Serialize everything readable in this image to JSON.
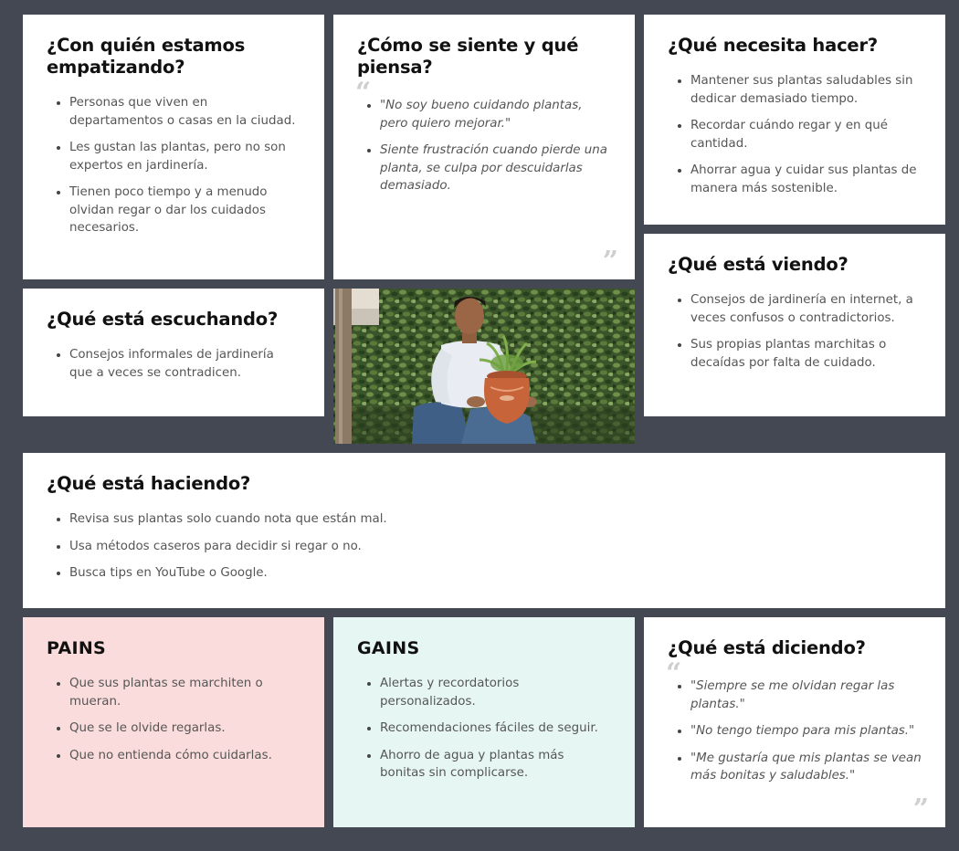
{
  "who": {
    "title": "¿Con quién estamos empatizando?",
    "items": [
      "Personas que viven en departamentos o casas en la ciudad.",
      "Les gustan las plantas, pero no son expertos en jardinería.",
      "Tienen poco tiempo y a menudo olvidan regar o dar los cuidados necesarios."
    ]
  },
  "feel": {
    "title": "¿Cómo se siente y qué piensa?",
    "quote_open": "“",
    "quote_close": "”",
    "items": [
      "\"No soy bueno cuidando plantas, pero quiero mejorar.\"",
      "Siente frustración cuando pierde una planta, se culpa por descuidarlas demasiado."
    ]
  },
  "do": {
    "title": "¿Qué necesita hacer?",
    "items": [
      "Mantener sus plantas saludables sin dedicar demasiado tiempo.",
      "Recordar cuándo regar y en qué cantidad.",
      "Ahorrar agua y cuidar sus plantas de manera más sostenible."
    ]
  },
  "see": {
    "title": "¿Qué está viendo?",
    "items": [
      "Consejos de jardinería en internet, a veces confusos o contradictorios.",
      "Sus propias plantas marchitas o decaídas por falta de cuidado."
    ]
  },
  "hear": {
    "title": "¿Qué está escuchando?",
    "items": [
      "Consejos informales de jardinería que a veces se contradicen."
    ]
  },
  "photo": {
    "icon": "person-holding-plant-photo"
  },
  "doing": {
    "title": "¿Qué está haciendo?",
    "items": [
      "Revisa sus plantas solo cuando nota que están mal.",
      "Usa métodos caseros para decidir si regar o no.",
      "Busca tips en YouTube o Google."
    ]
  },
  "pains": {
    "title": "PAINS",
    "color": "#fadcdc",
    "items": [
      "Que sus plantas se marchiten o mueran.",
      "Que se le olvide regarlas.",
      "Que no entienda cómo cuidarlas."
    ]
  },
  "gains": {
    "title": "GAINS",
    "color": "#e6f7f3",
    "items": [
      "Alertas y recordatorios personalizados.",
      "Recomendaciones fáciles de seguir.",
      "Ahorro de agua y plantas más bonitas sin complicarse."
    ]
  },
  "say": {
    "title": "¿Qué está diciendo?",
    "quote_open": "“",
    "quote_close": "”",
    "items": [
      "\"Siempre se me olvidan regar las plantas.\"",
      "\"No tengo tiempo para mis plantas.\"",
      "\"Me gustaría que mis plantas se vean más bonitas y saludables.\""
    ]
  }
}
